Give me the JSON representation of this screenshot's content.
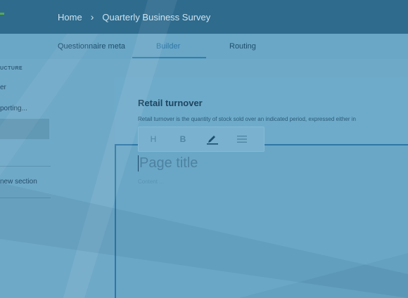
{
  "header": {
    "breadcrumb": [
      "Home",
      "Quarterly Business Survey"
    ],
    "separator": "›"
  },
  "tabs": [
    {
      "label": "Questionnaire meta"
    },
    {
      "label": "Builder"
    },
    {
      "label": "Routing"
    }
  ],
  "sidebar": {
    "heading": "UCTURE",
    "items": [
      {
        "label": "er"
      },
      {
        "label": "porting..."
      },
      {
        "label": "new section"
      }
    ]
  },
  "question": {
    "title": "Retail turnover",
    "description": "Retail turnover is the quantity of stock sold over an indicated period, expressed either in"
  },
  "toolbar": {
    "heading_label": "H",
    "bold_label": "B"
  },
  "editor": {
    "title_placeholder": "Page title",
    "content_placeholder": "Content ..."
  },
  "colors": {
    "header_bg": "#2e6b8d",
    "accent": "#2f7fb1",
    "page_bg": "#6fa9c8"
  }
}
